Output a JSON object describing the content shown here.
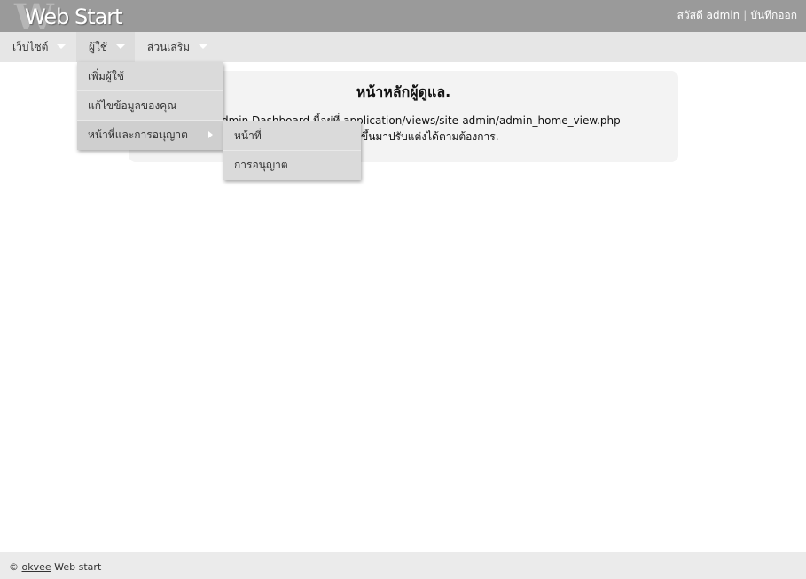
{
  "app": {
    "logo_mark": "W",
    "logo_text": "Web Start"
  },
  "userbar": {
    "greeting": "สวัสดี admin",
    "separator": "|",
    "logout": "บันทึกออก"
  },
  "nav": {
    "items": [
      {
        "label": "เว็บไซต์"
      },
      {
        "label": "ผู้ใช้"
      },
      {
        "label": "ส่วนเสริม"
      }
    ]
  },
  "users_menu": {
    "items": [
      {
        "label": "เพิ่มผู้ใช้"
      },
      {
        "label": "แก้ไขข้อมูลของคุณ"
      },
      {
        "label": "หน้าที่และการอนุญาต"
      }
    ]
  },
  "roles_submenu": {
    "items": [
      {
        "label": "หน้าที่"
      },
      {
        "label": "การอนุญาต"
      }
    ]
  },
  "main": {
    "title": "หน้าหลักผู้ดูแล.",
    "line1": "dmin Dashboard นี้อยู่ที่ application/views/site-admin/admin_home_view.php",
    "line2": "ขึ้นมาปรับแต่งได้ตามต้องการ."
  },
  "footer": {
    "copyright": "©",
    "link": "okvee",
    "suffix": " Web start"
  }
}
